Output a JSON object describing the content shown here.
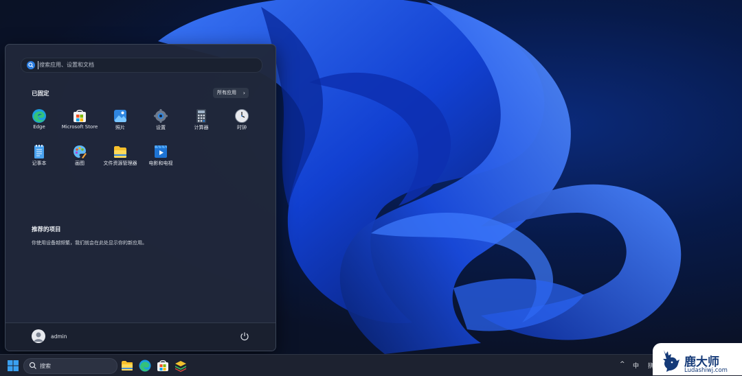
{
  "start_menu": {
    "search_placeholder": "搜索应用、设置和文档",
    "pinned_title": "已固定",
    "all_apps_label": "所有应用",
    "pinned_apps": [
      {
        "label": "Edge",
        "icon": "edge-icon"
      },
      {
        "label": "Microsoft Store",
        "icon": "store-icon"
      },
      {
        "label": "照片",
        "icon": "photos-icon"
      },
      {
        "label": "设置",
        "icon": "settings-icon"
      },
      {
        "label": "计算器",
        "icon": "calculator-icon"
      },
      {
        "label": "时钟",
        "icon": "clock-icon"
      },
      {
        "label": "记事本",
        "icon": "notepad-icon"
      },
      {
        "label": "画图",
        "icon": "paint-icon"
      },
      {
        "label": "文件资源管理器",
        "icon": "file-explorer-icon"
      },
      {
        "label": "电影和电视",
        "icon": "movies-tv-icon"
      }
    ],
    "recommended_title": "推荐的项目",
    "recommended_text": "你使用设备越频繁，我们就会在此处显示你的新应用。",
    "user_name": "admin"
  },
  "taskbar": {
    "search_label": "搜索",
    "tray_lang": "中",
    "tray_ime": "拼"
  },
  "watermark": {
    "brand_cn": "鹿大师",
    "brand_url": "Ludashiwj.com"
  },
  "colors": {
    "accent": "#1f6ae0",
    "menu_bg": "#20283a",
    "taskbar_bg": "#1d2230"
  }
}
